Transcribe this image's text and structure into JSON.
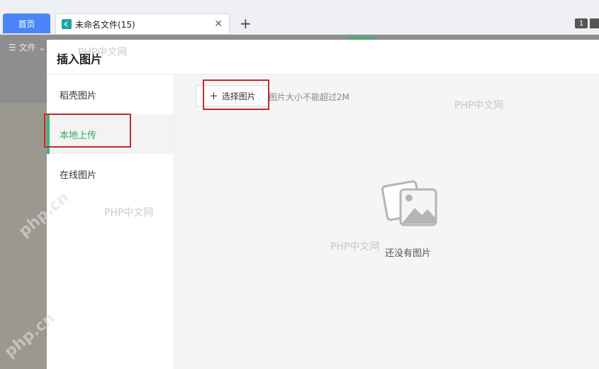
{
  "tabs": {
    "home_label": "首页",
    "doc_title": "未命名文件(15)",
    "close_glyph": "✕",
    "new_tab_glyph": "+",
    "window_count": "1"
  },
  "app": {
    "file_menu_label": "☰ 文件 ⌄"
  },
  "dialog": {
    "title": "插入图片",
    "sidebar": [
      {
        "label": "稻壳图片",
        "active": false
      },
      {
        "label": "本地上传",
        "active": true
      },
      {
        "label": "在线图片",
        "active": false
      }
    ],
    "select_button_plus": "+",
    "select_button_label": "选择图片",
    "size_hint": "图片大小不能超过2M",
    "empty_text": "还没有图片",
    "empty_icon": "image-placeholder-icon"
  },
  "watermarks": {
    "text": "PHP中文网",
    "site": "php.cn"
  },
  "colors": {
    "accent_green": "#3ab977",
    "home_tab_blue": "#4a86f7",
    "highlight_red": "#c62828"
  }
}
